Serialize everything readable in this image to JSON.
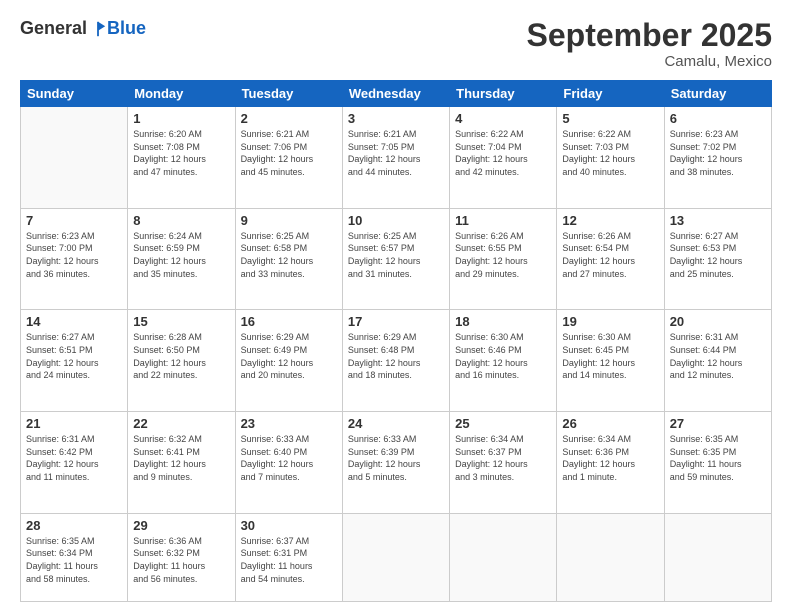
{
  "header": {
    "logo": {
      "general": "General",
      "blue": "Blue"
    },
    "title": "September 2025",
    "location": "Camalu, Mexico"
  },
  "weekdays": [
    "Sunday",
    "Monday",
    "Tuesday",
    "Wednesday",
    "Thursday",
    "Friday",
    "Saturday"
  ],
  "weeks": [
    [
      {
        "day": "",
        "info": ""
      },
      {
        "day": "1",
        "info": "Sunrise: 6:20 AM\nSunset: 7:08 PM\nDaylight: 12 hours\nand 47 minutes."
      },
      {
        "day": "2",
        "info": "Sunrise: 6:21 AM\nSunset: 7:06 PM\nDaylight: 12 hours\nand 45 minutes."
      },
      {
        "day": "3",
        "info": "Sunrise: 6:21 AM\nSunset: 7:05 PM\nDaylight: 12 hours\nand 44 minutes."
      },
      {
        "day": "4",
        "info": "Sunrise: 6:22 AM\nSunset: 7:04 PM\nDaylight: 12 hours\nand 42 minutes."
      },
      {
        "day": "5",
        "info": "Sunrise: 6:22 AM\nSunset: 7:03 PM\nDaylight: 12 hours\nand 40 minutes."
      },
      {
        "day": "6",
        "info": "Sunrise: 6:23 AM\nSunset: 7:02 PM\nDaylight: 12 hours\nand 38 minutes."
      }
    ],
    [
      {
        "day": "7",
        "info": "Sunrise: 6:23 AM\nSunset: 7:00 PM\nDaylight: 12 hours\nand 36 minutes."
      },
      {
        "day": "8",
        "info": "Sunrise: 6:24 AM\nSunset: 6:59 PM\nDaylight: 12 hours\nand 35 minutes."
      },
      {
        "day": "9",
        "info": "Sunrise: 6:25 AM\nSunset: 6:58 PM\nDaylight: 12 hours\nand 33 minutes."
      },
      {
        "day": "10",
        "info": "Sunrise: 6:25 AM\nSunset: 6:57 PM\nDaylight: 12 hours\nand 31 minutes."
      },
      {
        "day": "11",
        "info": "Sunrise: 6:26 AM\nSunset: 6:55 PM\nDaylight: 12 hours\nand 29 minutes."
      },
      {
        "day": "12",
        "info": "Sunrise: 6:26 AM\nSunset: 6:54 PM\nDaylight: 12 hours\nand 27 minutes."
      },
      {
        "day": "13",
        "info": "Sunrise: 6:27 AM\nSunset: 6:53 PM\nDaylight: 12 hours\nand 25 minutes."
      }
    ],
    [
      {
        "day": "14",
        "info": "Sunrise: 6:27 AM\nSunset: 6:51 PM\nDaylight: 12 hours\nand 24 minutes."
      },
      {
        "day": "15",
        "info": "Sunrise: 6:28 AM\nSunset: 6:50 PM\nDaylight: 12 hours\nand 22 minutes."
      },
      {
        "day": "16",
        "info": "Sunrise: 6:29 AM\nSunset: 6:49 PM\nDaylight: 12 hours\nand 20 minutes."
      },
      {
        "day": "17",
        "info": "Sunrise: 6:29 AM\nSunset: 6:48 PM\nDaylight: 12 hours\nand 18 minutes."
      },
      {
        "day": "18",
        "info": "Sunrise: 6:30 AM\nSunset: 6:46 PM\nDaylight: 12 hours\nand 16 minutes."
      },
      {
        "day": "19",
        "info": "Sunrise: 6:30 AM\nSunset: 6:45 PM\nDaylight: 12 hours\nand 14 minutes."
      },
      {
        "day": "20",
        "info": "Sunrise: 6:31 AM\nSunset: 6:44 PM\nDaylight: 12 hours\nand 12 minutes."
      }
    ],
    [
      {
        "day": "21",
        "info": "Sunrise: 6:31 AM\nSunset: 6:42 PM\nDaylight: 12 hours\nand 11 minutes."
      },
      {
        "day": "22",
        "info": "Sunrise: 6:32 AM\nSunset: 6:41 PM\nDaylight: 12 hours\nand 9 minutes."
      },
      {
        "day": "23",
        "info": "Sunrise: 6:33 AM\nSunset: 6:40 PM\nDaylight: 12 hours\nand 7 minutes."
      },
      {
        "day": "24",
        "info": "Sunrise: 6:33 AM\nSunset: 6:39 PM\nDaylight: 12 hours\nand 5 minutes."
      },
      {
        "day": "25",
        "info": "Sunrise: 6:34 AM\nSunset: 6:37 PM\nDaylight: 12 hours\nand 3 minutes."
      },
      {
        "day": "26",
        "info": "Sunrise: 6:34 AM\nSunset: 6:36 PM\nDaylight: 12 hours\nand 1 minute."
      },
      {
        "day": "27",
        "info": "Sunrise: 6:35 AM\nSunset: 6:35 PM\nDaylight: 11 hours\nand 59 minutes."
      }
    ],
    [
      {
        "day": "28",
        "info": "Sunrise: 6:35 AM\nSunset: 6:34 PM\nDaylight: 11 hours\nand 58 minutes."
      },
      {
        "day": "29",
        "info": "Sunrise: 6:36 AM\nSunset: 6:32 PM\nDaylight: 11 hours\nand 56 minutes."
      },
      {
        "day": "30",
        "info": "Sunrise: 6:37 AM\nSunset: 6:31 PM\nDaylight: 11 hours\nand 54 minutes."
      },
      {
        "day": "",
        "info": ""
      },
      {
        "day": "",
        "info": ""
      },
      {
        "day": "",
        "info": ""
      },
      {
        "day": "",
        "info": ""
      }
    ]
  ]
}
